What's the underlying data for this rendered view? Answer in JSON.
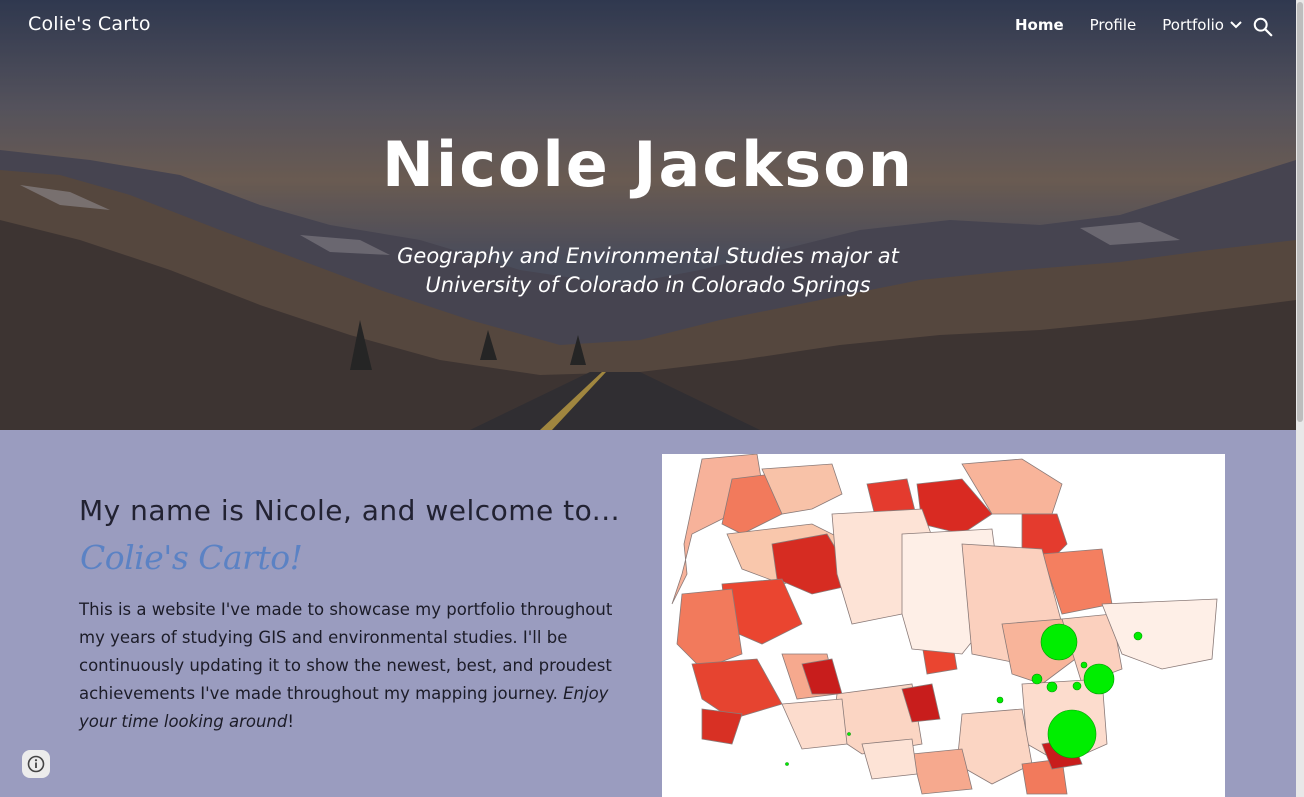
{
  "header": {
    "site_title": "Colie's Carto",
    "nav": {
      "home": "Home",
      "profile": "Profile",
      "portfolio": "Portfolio"
    }
  },
  "hero": {
    "name": "Nicole Jackson",
    "subtitle_line1": "Geography and Environmental Studies major at",
    "subtitle_line2": "University of Colorado in Colorado Springs"
  },
  "intro": {
    "welcome": "My name is Nicole, and welcome to...",
    "brand": "Colie's Carto!",
    "paragraph": "This is a website I've made to showcase my portfolio throughout my years of studying GIS and environmental studies. I'll be continuously updating it to show the newest, best, and proudest achievements I've made throughout my mapping journey. ",
    "paragraph_italic": "Enjoy your time looking around",
    "paragraph_end": "!"
  },
  "colors": {
    "content_bg": "#9a9cbf",
    "brand_accent": "#5b82c4",
    "map_point": "#00ee00"
  },
  "icons": {
    "nav_dropdown": "chevron-down-icon",
    "search": "search-icon",
    "info": "info-icon"
  }
}
